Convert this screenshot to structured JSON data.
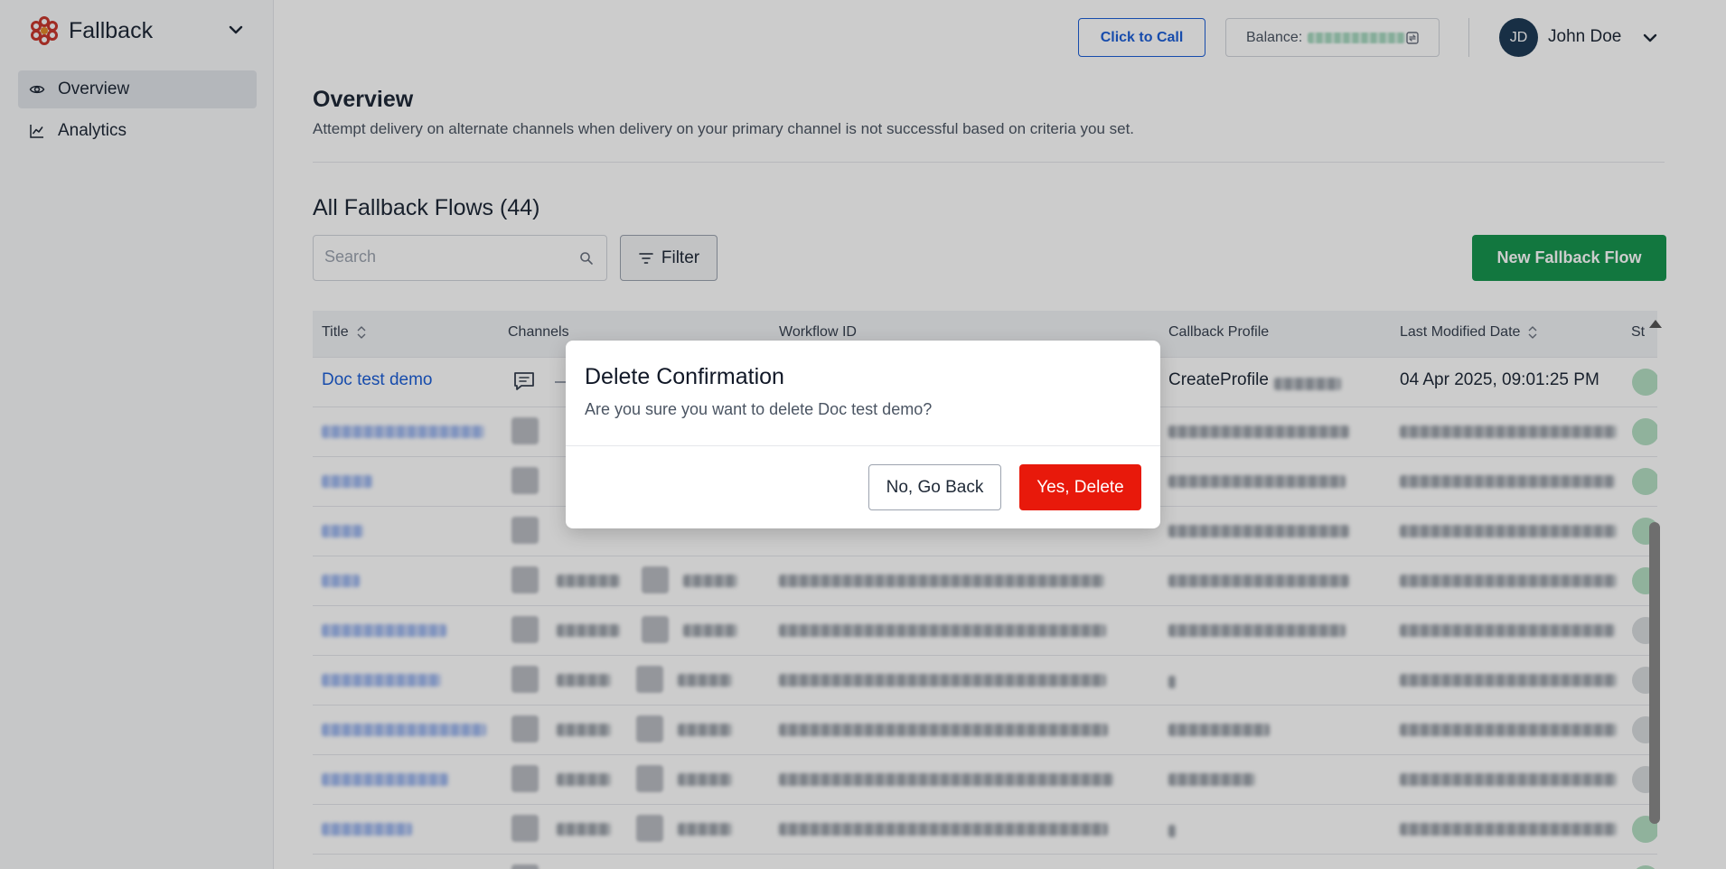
{
  "app": {
    "name": "Fallback",
    "logo_icon": "flower-logo-icon",
    "brand_color": "#c8372d"
  },
  "sidebar": {
    "items": [
      {
        "label": "Overview",
        "icon": "eye-icon",
        "active": true
      },
      {
        "label": "Analytics",
        "icon": "line-chart-icon",
        "active": false
      }
    ]
  },
  "header": {
    "call_label": "Click to Call",
    "balance_label": "Balance:",
    "user_initials": "JD",
    "user_name": "John Doe"
  },
  "page": {
    "title": "Overview",
    "subtitle": "Attempt delivery on alternate channels when delivery on your primary channel is not successful based on criteria you set.",
    "section_title": "All Fallback Flows (44)"
  },
  "toolbar": {
    "search_placeholder": "Search",
    "filter_label": "Filter",
    "new_label": "New Fallback Flow"
  },
  "table": {
    "columns": [
      "Title",
      "Channels",
      "Workflow ID",
      "Callback Profile",
      "Last Modified Date",
      "St"
    ],
    "first_row": {
      "title": "Doc test demo",
      "callback_profile": "CreateProfile",
      "last_modified": "04 Apr 2025, 09:01:25 PM"
    }
  },
  "modal": {
    "title": "Delete Confirmation",
    "message": "Are you sure you want to delete Doc test demo?",
    "cancel_label": "No, Go Back",
    "confirm_label": "Yes, Delete"
  },
  "colors": {
    "primary": "#1d5fd8",
    "success": "#17954f",
    "danger": "#e8190b"
  }
}
